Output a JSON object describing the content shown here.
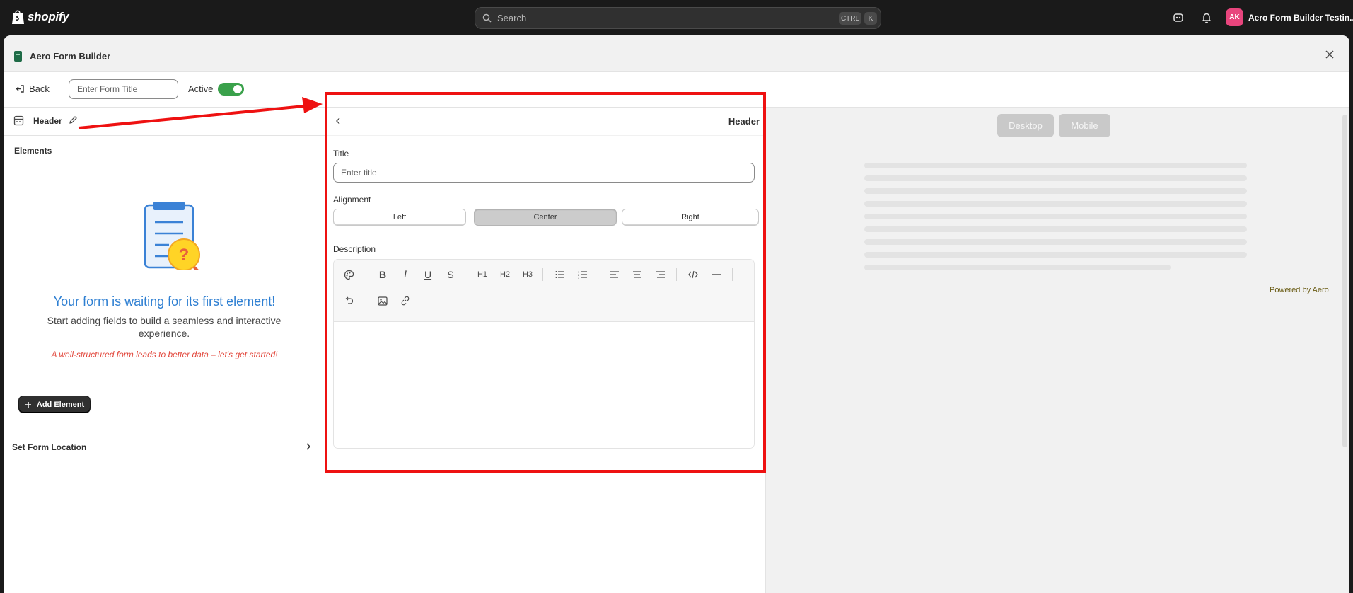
{
  "shopify": {
    "logo_text": "shopify",
    "search_placeholder": "Search",
    "shortcut_ctrl": "CTRL",
    "shortcut_k": "K",
    "store_initials": "AK",
    "store_name": "Aero Form Builder Testin..."
  },
  "app": {
    "title": "Aero Form Builder"
  },
  "toolbar": {
    "back_label": "Back",
    "form_title_placeholder": "Enter Form Title",
    "active_label": "Active",
    "active_on": true
  },
  "left": {
    "section_label": "Header",
    "elements_title": "Elements",
    "empty_title": "Your form is waiting for its first element!",
    "empty_subtitle": "Start adding fields to build a seamless and interactive experience.",
    "empty_hint": "A well-structured form leads to better data – let's get started!",
    "add_button": "Add Element",
    "location_label": "Set Form Location"
  },
  "editor": {
    "panel_title": "Header",
    "title_label": "Title",
    "title_placeholder": "Enter title",
    "alignment_label": "Alignment",
    "alignment_options": [
      "Left",
      "Center",
      "Right"
    ],
    "alignment_selected": "Center",
    "description_label": "Description",
    "toolbar_row1": [
      "palette-icon",
      "bold-icon",
      "italic-icon",
      "underline-icon",
      "strikethrough-icon",
      "h1",
      "h2",
      "h3",
      "bullet-list-icon",
      "numbered-list-icon",
      "align-left-icon",
      "align-center-icon",
      "align-right-icon",
      "code-icon",
      "horizontal-rule-icon"
    ],
    "toolbar_row2": [
      "undo-icon",
      "image-icon",
      "link-icon"
    ],
    "h1_label": "H1",
    "h2_label": "H2",
    "h3_label": "H3"
  },
  "preview": {
    "desktop_label": "Desktop",
    "mobile_label": "Mobile",
    "powered_by": "Powered by Aero"
  },
  "annotation": {
    "highlight_color": "#ee1111"
  }
}
